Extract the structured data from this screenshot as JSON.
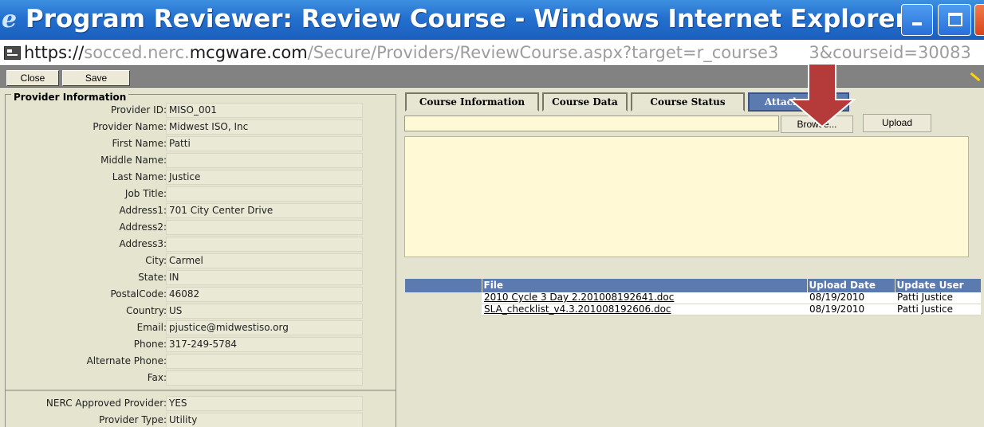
{
  "window": {
    "title": "Program Reviewer: Review Course - Windows Internet Explorer...",
    "url_prefix": "https://",
    "url_sub": "socced.nerc.",
    "url_domain": "mcgware.com",
    "url_path": "/Secure/Providers/ReviewCourse.aspx?target=r_course3",
    "url_tail": "3&courseid=30083"
  },
  "toolbar": {
    "close_label": "Close",
    "save_label": "Save"
  },
  "provider": {
    "legend": "Provider Information",
    "fields": [
      {
        "label": "Provider ID:",
        "value": "MISO_001"
      },
      {
        "label": "Provider Name:",
        "value": "Midwest ISO, Inc"
      },
      {
        "label": "First Name:",
        "value": "Patti"
      },
      {
        "label": "Middle Name:",
        "value": ""
      },
      {
        "label": "Last Name:",
        "value": "Justice"
      },
      {
        "label": "Job Title:",
        "value": ""
      },
      {
        "label": "Address1:",
        "value": "701 City Center Drive"
      },
      {
        "label": "Address2:",
        "value": ""
      },
      {
        "label": "Address3:",
        "value": ""
      },
      {
        "label": "City:",
        "value": "Carmel"
      },
      {
        "label": "State:",
        "value": "IN"
      },
      {
        "label": "PostalCode:",
        "value": "46082"
      },
      {
        "label": "Country:",
        "value": "US"
      },
      {
        "label": "Email:",
        "value": "pjustice@midwestiso.org"
      },
      {
        "label": "Phone:",
        "value": "317-249-5784"
      },
      {
        "label": "Alternate Phone:",
        "value": ""
      },
      {
        "label": "Fax:",
        "value": ""
      }
    ],
    "nerc_approved_label": "NERC Approved Provider:",
    "nerc_approved_value": "YES",
    "provider_type_label": "Provider Type:",
    "provider_type_value": "Utility"
  },
  "tabs": [
    {
      "label": "Course Information",
      "active": false
    },
    {
      "label": "Course Data",
      "active": false
    },
    {
      "label": "Course Status",
      "active": false
    },
    {
      "label": "Attachments",
      "active": true
    }
  ],
  "attachments": {
    "file_input_value": "",
    "browse_label": "Browse...",
    "upload_label": "Upload",
    "columns": [
      "File",
      "Upload Date",
      "Update User"
    ],
    "rows": [
      {
        "file": "2010 Cycle 3 Day 2.201008192641.doc",
        "date": "08/19/2010",
        "user": "Patti Justice"
      },
      {
        "file": "SLA_checklist_v4.3.201008192606.doc",
        "date": "08/19/2010",
        "user": "Patti Justice"
      }
    ]
  },
  "colors": {
    "titlebar": "#2470cf",
    "tab_active": "#5a7ab0",
    "panel_bg": "#e3e3cf",
    "input_bg": "#fffad5",
    "arrow_fill": "#b53a3a"
  }
}
